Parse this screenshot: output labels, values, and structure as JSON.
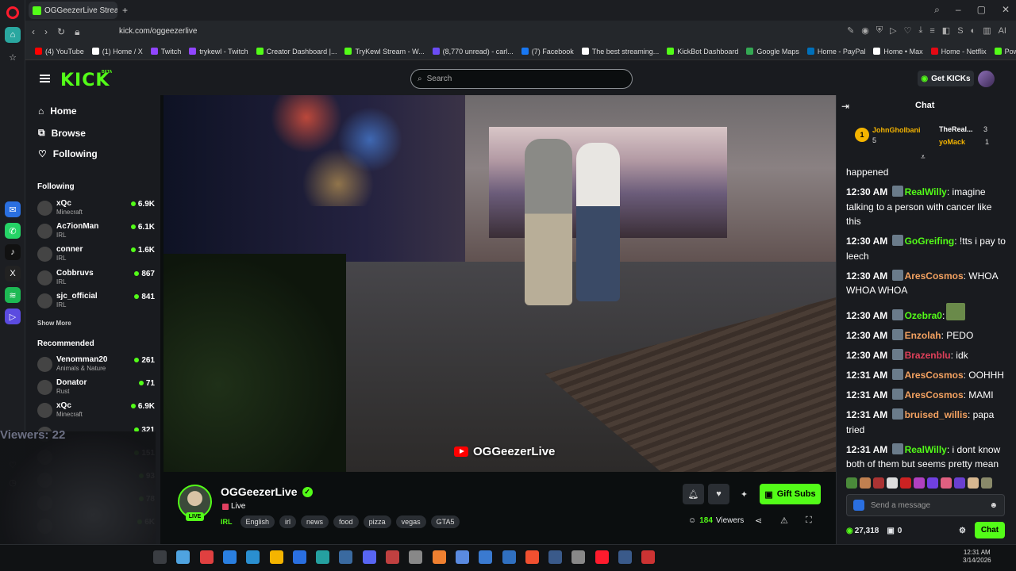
{
  "browser": {
    "tab_title": "OGGeezerLive Stream",
    "url": "kick.com/oggeezerlive",
    "bookmarks": [
      {
        "label": "(4) YouTube",
        "color": "#ff0000"
      },
      {
        "label": "(1) Home / X",
        "color": "#ffffff"
      },
      {
        "label": "Twitch",
        "color": "#9146ff"
      },
      {
        "label": "trykewl - Twitch",
        "color": "#9146ff"
      },
      {
        "label": "Creator Dashboard |...",
        "color": "#53fc18"
      },
      {
        "label": "TryKewl Stream - W...",
        "color": "#53fc18"
      },
      {
        "label": "(8,770 unread) - carl...",
        "color": "#6b4cf5"
      },
      {
        "label": "(7) Facebook",
        "color": "#1877f2"
      },
      {
        "label": "The best streaming...",
        "color": "#ffffff"
      },
      {
        "label": "KickBot Dashboard",
        "color": "#53fc18"
      },
      {
        "label": "Google Maps",
        "color": "#34a853"
      },
      {
        "label": "Home - PayPal",
        "color": "#0070ba"
      },
      {
        "label": "Home • Max",
        "color": "#ffffff"
      },
      {
        "label": "Home - Netflix",
        "color": "#e50914"
      },
      {
        "label": "Powerchat",
        "color": "#53fc18"
      }
    ]
  },
  "header": {
    "logo": "KICK",
    "beta": "BETA",
    "search_placeholder": "Search",
    "get_kicks": "Get KICKs"
  },
  "nav": {
    "home": "Home",
    "browse": "Browse",
    "following": "Following"
  },
  "following_section": {
    "title": "Following",
    "channels": [
      {
        "name": "xQc",
        "game": "Minecraft",
        "viewers": "6.9K"
      },
      {
        "name": "Ac7ionMan",
        "game": "IRL",
        "viewers": "6.1K"
      },
      {
        "name": "conner",
        "game": "IRL",
        "viewers": "1.6K"
      },
      {
        "name": "Cobbruvs",
        "game": "IRL",
        "viewers": "867"
      },
      {
        "name": "sjc_official",
        "game": "IRL",
        "viewers": "841"
      }
    ],
    "show_more": "Show More"
  },
  "recommended_section": {
    "title": "Recommended",
    "channels": [
      {
        "name": "Venomman20",
        "game": "Animals & Nature",
        "viewers": "261"
      },
      {
        "name": "Donator",
        "game": "Rust",
        "viewers": "71"
      },
      {
        "name": "xQc",
        "game": "Minecraft",
        "viewers": "6.9K"
      },
      {
        "name": "",
        "game": "",
        "viewers": "321"
      },
      {
        "name": "",
        "game": "",
        "viewers": "151"
      },
      {
        "name": "",
        "game": "",
        "viewers": "93"
      },
      {
        "name": "",
        "game": "",
        "viewers": "78"
      },
      {
        "name": "",
        "game": "",
        "viewers": "6K"
      }
    ]
  },
  "overlay": {
    "viewers_label": "Viewers: 22"
  },
  "video": {
    "watermark": "OGGeezerLive"
  },
  "stream": {
    "streamer": "OGGeezerLive",
    "live_badge": "LIVE",
    "title": "Live",
    "category": "IRL",
    "tags": [
      "English",
      "irl",
      "news",
      "food",
      "pizza",
      "vegas",
      "GTA5"
    ],
    "gift_subs": "Gift Subs",
    "viewer_count": "184",
    "viewers_label": "Viewers"
  },
  "chat": {
    "title": "Chat",
    "pinned": [
      {
        "name": "JohnGholbani",
        "count": "5",
        "rank": "1",
        "color": "#f4b400"
      },
      {
        "name": "TheReal...",
        "count": "3",
        "color": "#ffffff"
      },
      {
        "name": "yoMack",
        "count": "1",
        "color": "#f4b400"
      }
    ],
    "messages": [
      {
        "time": "",
        "user": "",
        "color": "#ffffff",
        "text": "happened"
      },
      {
        "time": "12:30 AM",
        "user": "RealWilly",
        "color": "#53fc18",
        "text": ": imagine talking to a person with cancer like this"
      },
      {
        "time": "12:30 AM",
        "user": "GoGreifing",
        "color": "#53fc18",
        "text": ": !tts i pay to leech"
      },
      {
        "time": "12:30 AM",
        "user": "AresCosmos",
        "color": "#f4a261",
        "text": ": WHOA WHOA WHOA"
      },
      {
        "time": "12:30 AM",
        "user": "Ozebra0",
        "color": "#53fc18",
        "text": ":"
      },
      {
        "time": "12:30 AM",
        "user": "Enzolah",
        "color": "#f4a261",
        "text": ": PEDO"
      },
      {
        "time": "12:30 AM",
        "user": "Brazenblu",
        "color": "#e0405a",
        "text": ": idk"
      },
      {
        "time": "12:31 AM",
        "user": "AresCosmos",
        "color": "#f4a261",
        "text": ": OOHHH"
      },
      {
        "time": "12:31 AM",
        "user": "AresCosmos",
        "color": "#f4a261",
        "text": ": MAMI"
      },
      {
        "time": "12:31 AM",
        "user": "bruised_willis",
        "color": "#f4a261",
        "text": ": papa tried"
      },
      {
        "time": "12:31 AM",
        "user": "RealWilly",
        "color": "#53fc18",
        "text": ": i dont know both of them but seems pretty mean"
      }
    ],
    "send_placeholder": "Send a message",
    "points": "27,318",
    "gifts": "0",
    "chat_button": "Chat"
  },
  "taskbar": {
    "time": "12:31 AM",
    "date": "3/14/2026"
  }
}
